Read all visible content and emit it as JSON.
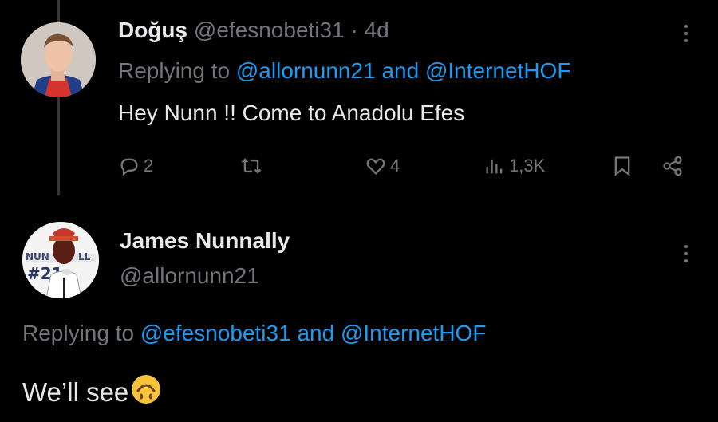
{
  "tweet1": {
    "display_name": "Doğuş",
    "handle": "@efesnobeti31",
    "separator": "·",
    "time": "4d",
    "replying_prefix": "Replying to",
    "reply_user_1": "@allornunn21",
    "reply_and": "and",
    "reply_user_2": "@InternetHOF",
    "text": "Hey Nunn !! Come to Anadolu Efes",
    "actions": {
      "reply_count": "2",
      "retweet_count": "",
      "like_count": "4",
      "view_count": "1,3K"
    }
  },
  "tweet2": {
    "display_name": "James Nunnally",
    "handle": "@allornunn21",
    "replying_prefix": "Replying to",
    "reply_user_1": "@efesnobeti31",
    "reply_and": "and",
    "reply_user_2": "@InternetHOF",
    "text": "We’ll see",
    "emoji": "upside-down-face",
    "avatar_lettering": "NUNNALLY #21"
  },
  "colors": {
    "background": "#000000",
    "text": "#e7e9ea",
    "muted": "#71767b",
    "link": "#1d9bf0",
    "thread_line": "#333639"
  },
  "icons": {
    "reply": "reply-icon",
    "retweet": "retweet-icon",
    "like": "heart-icon",
    "views": "views-icon",
    "bookmark": "bookmark-icon",
    "share": "share-icon",
    "more": "more-icon"
  }
}
